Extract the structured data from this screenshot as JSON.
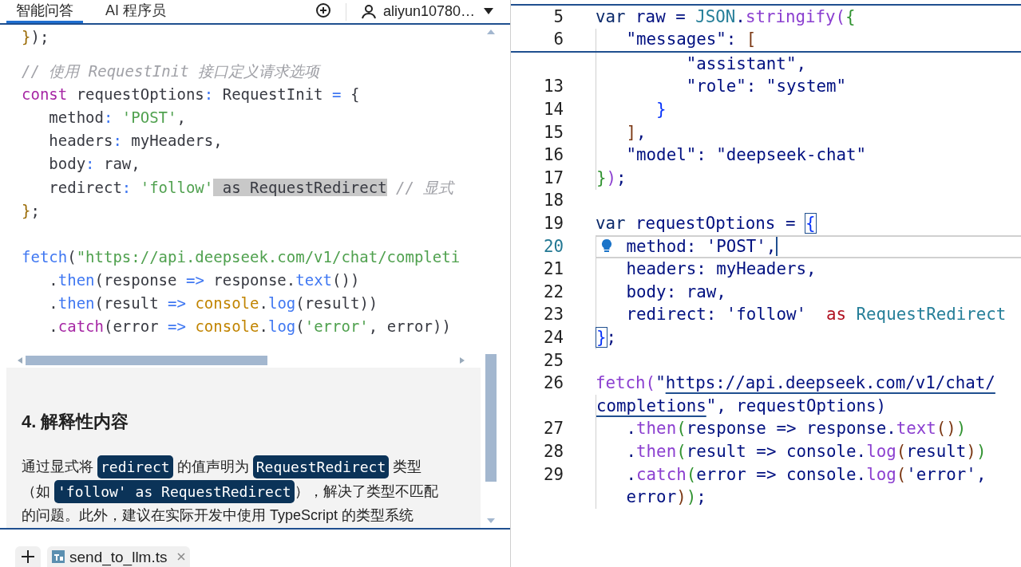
{
  "assistant_panel": {
    "tabs": [
      {
        "label": "智能问答",
        "selected": true
      },
      {
        "label": "AI 程序员",
        "selected": false
      }
    ],
    "user": "aliyun10780…",
    "code_block": {
      "lines": [
        {
          "kind": "code",
          "text": "});"
        },
        {
          "kind": "blank"
        },
        {
          "kind": "code",
          "text": "// 使用 RequestInit 接口定义请求选项"
        },
        {
          "kind": "code",
          "text": "const requestOptions: RequestInit = {"
        },
        {
          "kind": "code",
          "text": "   method: 'POST',"
        },
        {
          "kind": "code",
          "text": "   headers: myHeaders,"
        },
        {
          "kind": "code",
          "text": "   body: raw,"
        },
        {
          "kind": "code",
          "segments": [
            {
              "text": "   redirect: 'follow'",
              "kind": "code"
            },
            {
              "text": " as RequestRedirect",
              "kind": "highlight"
            },
            {
              "text": " // 显式",
              "kind": "code"
            }
          ]
        },
        {
          "kind": "code",
          "text": "};"
        },
        {
          "kind": "blank"
        },
        {
          "kind": "code",
          "text": "fetch(\"https://api.deepseek.com/v1/chat/completi"
        },
        {
          "kind": "code",
          "text": "   .then(response => response.text())"
        },
        {
          "kind": "code",
          "text": "   .then(result => console.log(result))"
        },
        {
          "kind": "code",
          "text": "   .catch(error => console.log('error', error))"
        }
      ]
    },
    "section": {
      "heading": "4. 解释性内容",
      "lines": [
        [
          {
            "text": "通过显式将 ",
            "kind": "text"
          },
          {
            "text": "redirect",
            "kind": "code"
          },
          {
            "text": " 的值声明为 ",
            "kind": "text"
          },
          {
            "text": "RequestRedirect",
            "kind": "code"
          },
          {
            "text": " 类型",
            "kind": "text"
          }
        ],
        [
          {
            "text": "（如 ",
            "kind": "text"
          },
          {
            "text": "'follow' as RequestRedirect",
            "kind": "code"
          },
          {
            "text": "），解决了类型不匹配",
            "kind": "text"
          }
        ],
        [
          {
            "text": "的问题。此外，建议在实际开发中使用 TypeScript 的类型系统",
            "kind": "text"
          }
        ]
      ]
    }
  },
  "file_tabs": [
    {
      "name": "send_to_llm.ts",
      "kind": "ts"
    }
  ],
  "editor": {
    "sticky_lines": [
      {
        "n": "5",
        "text": "var raw = JSON.stringify({",
        "current": false
      },
      {
        "n": "6",
        "text": "   \"messages\": [",
        "current": false
      }
    ],
    "lines": [
      {
        "text": "         \"assistant\",",
        "current": false
      },
      {
        "n": "13",
        "text": "         \"role\": \"system\"",
        "current": false
      },
      {
        "n": "14",
        "text": "      }",
        "current": false,
        "bracket_match": false
      },
      {
        "n": "15",
        "text": "   ],",
        "current": false
      },
      {
        "n": "16",
        "text": "   \"model\": \"deepseek-chat\"",
        "current": false
      },
      {
        "n": "17",
        "text": "});",
        "current": false,
        "bracket_match": false
      },
      {
        "n": "18",
        "current": false
      },
      {
        "n": "19",
        "text": "var requestOptions = {",
        "current": false,
        "bracket_match": true
      },
      {
        "n": "20",
        "text": "   method: 'POST',",
        "current": true
      },
      {
        "n": "21",
        "text": "   headers: myHeaders,",
        "current": false
      },
      {
        "n": "22",
        "text": "   body: raw,",
        "current": false
      },
      {
        "n": "23",
        "text": "   redirect: 'follow'  as RequestRedirect",
        "current": false
      },
      {
        "n": "24",
        "text": "};",
        "current": false,
        "bracket_match": true
      },
      {
        "n": "25",
        "current": false
      },
      {
        "n": "26",
        "segments": [
          {
            "text": "fetch(\"",
            "kind": "code"
          },
          {
            "text": "https://api.deepseek.com/v1/chat/",
            "kind": "link"
          }
        ],
        "current": false
      },
      {
        "segments": [
          {
            "text": "completions",
            "kind": "link"
          },
          {
            "text": "\", requestOptions)",
            "kind": "code"
          }
        ],
        "current": false
      },
      {
        "n": "27",
        "text": "   .then(response => response.text())",
        "current": false
      },
      {
        "n": "28",
        "text": "   .then(result => console.log(result))",
        "current": false
      },
      {
        "n": "29",
        "text": "   .catch(error => console.log('error',",
        "current": false
      },
      {
        "text": "   error));",
        "current": false
      }
    ]
  }
}
